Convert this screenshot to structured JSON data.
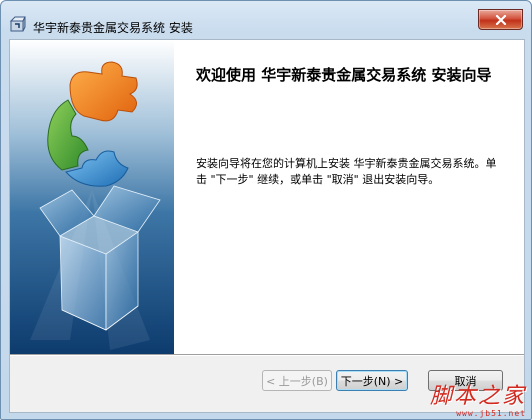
{
  "window": {
    "title": "华宇新泰贵金属交易系统 安装",
    "close_icon": "close-icon"
  },
  "wizard": {
    "heading": "欢迎使用 华宇新泰贵金属交易系统 安装向导",
    "body": "安装向导将在您的计算机上安装 华宇新泰贵金属交易系统。单击 \"下一步\" 继续，或单击 \"取消\" 退出安装向导。",
    "side_image": "puzzle-box-graphic"
  },
  "buttons": {
    "back": "< 上一步(B)",
    "next": "下一步(N) >",
    "cancel": "取消"
  },
  "watermark": {
    "text": "脚本之家",
    "url": "www.jb51.net"
  }
}
